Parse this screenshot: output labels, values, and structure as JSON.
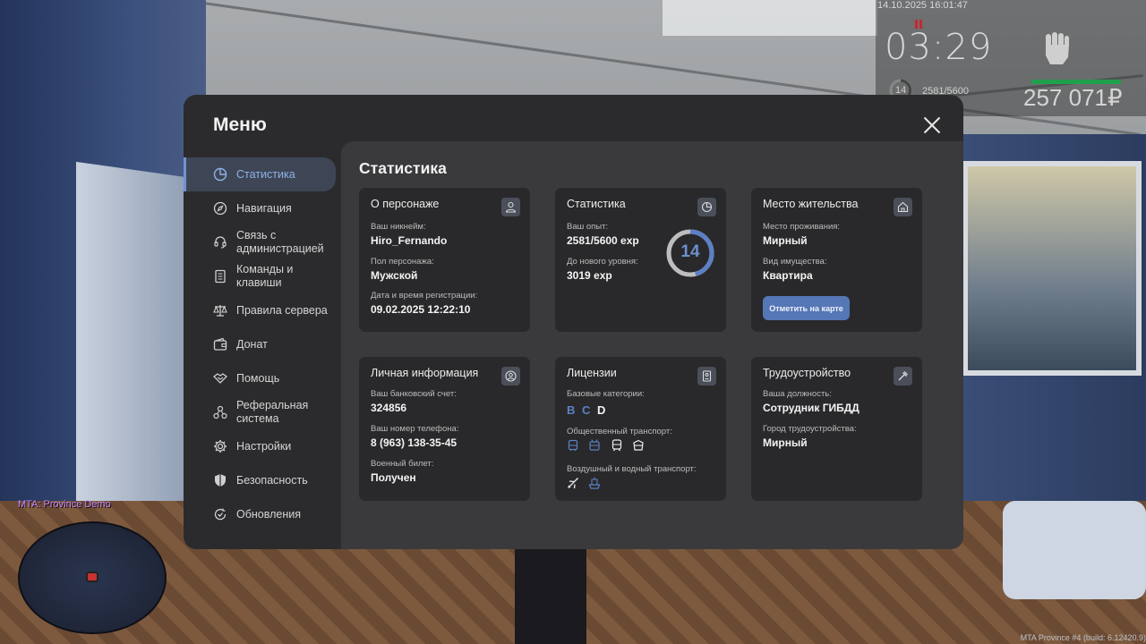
{
  "hud": {
    "datetime": "14.10.2025 16:01:47",
    "time": "03:29",
    "level": "14",
    "exp": "2581/5600",
    "money": "257 071₽"
  },
  "server_name": "MTA: Province Demo",
  "build": "MTA Province #4 (build: 6.12420.9)",
  "menu": {
    "title": "Меню",
    "sidebar": [
      {
        "label": "Статистика",
        "icon": "pie-chart-icon",
        "active": true
      },
      {
        "label": "Навигация",
        "icon": "compass-icon"
      },
      {
        "label": "Связь с администрацией",
        "icon": "headset-icon"
      },
      {
        "label": "Команды и клавиши",
        "icon": "document-icon"
      },
      {
        "label": "Правила сервера",
        "icon": "scales-icon"
      },
      {
        "label": "Донат",
        "icon": "wallet-icon"
      },
      {
        "label": "Помощь",
        "icon": "handshake-icon"
      },
      {
        "label": "Реферальная система",
        "icon": "network-icon"
      },
      {
        "label": "Настройки",
        "icon": "gear-icon"
      },
      {
        "label": "Безопасность",
        "icon": "shield-icon"
      },
      {
        "label": "Обновления",
        "icon": "refresh-check-icon"
      }
    ],
    "content_title": "Статистика",
    "cards": {
      "character": {
        "title": "О персонаже",
        "nickname_label": "Ваш никнейм:",
        "nickname": "Hiro_Fernando",
        "gender_label": "Пол персонажа:",
        "gender": "Мужской",
        "reg_label": "Дата и время регистрации:",
        "reg": "09.02.2025 12:22:10"
      },
      "stats": {
        "title": "Статистика",
        "exp_label": "Ваш опыт:",
        "exp": "2581/5600 exp",
        "next_label": "До нового уровня:",
        "next": "3019 exp",
        "level": "14",
        "progress": 0.4609
      },
      "residence": {
        "title": "Место жительства",
        "place_label": "Место проживания:",
        "place": "Мирный",
        "property_label": "Вид имущества:",
        "property": "Квартира",
        "button": "Отметить на карте"
      },
      "personal": {
        "title": "Личная информация",
        "bank_label": "Ваш банковский счет:",
        "bank": "324856",
        "phone_label": "Ваш номер телефона:",
        "phone": "8 (963) 138-35-45",
        "military_label": "Военный билет:",
        "military": "Получен"
      },
      "licenses": {
        "title": "Лицензии",
        "base_label": "Базовые категории:",
        "cat_b": "B",
        "cat_c": "C",
        "cat_d": "D",
        "public_label": "Общественный транспорт:",
        "air_label": "Воздушный и водный транспорт:",
        "colors": {
          "owned": "#5c80c4",
          "active": "#f0f0f0"
        }
      },
      "job": {
        "title": "Трудоустройство",
        "position_label": "Ваша должность:",
        "position": "Сотрудник ГИБДД",
        "city_label": "Город трудоустройства:",
        "city": "Мирный"
      }
    }
  }
}
